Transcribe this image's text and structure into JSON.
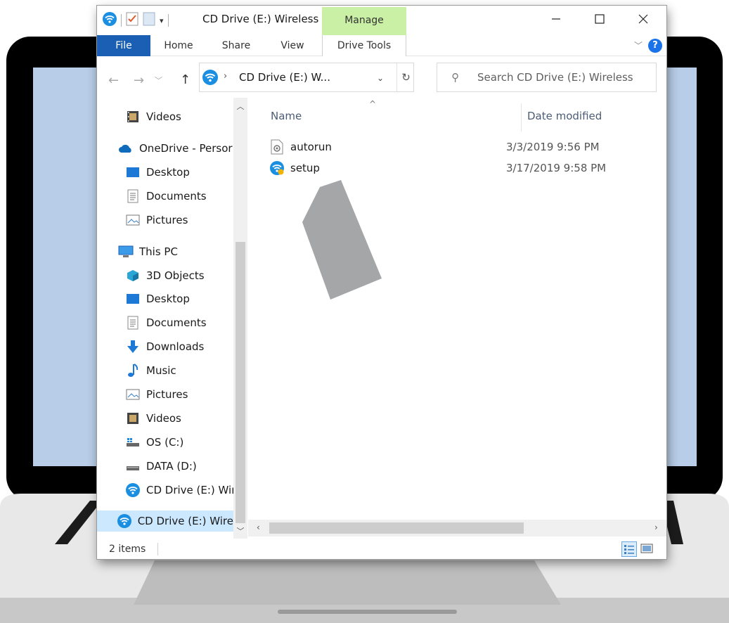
{
  "window": {
    "title": "CD Drive (E:) Wireless",
    "contextual_tab": "Manage",
    "contextual_tab_color": "#c9f0a5"
  },
  "ribbon": {
    "tabs": [
      "File",
      "Home",
      "Share",
      "View",
      "Drive Tools"
    ],
    "file_tab_color": "#1a5fb4"
  },
  "address_bar": {
    "path": "CD Drive (E:) W..."
  },
  "search": {
    "placeholder": "Search CD Drive (E:) Wireless"
  },
  "nav_pane": {
    "items": [
      {
        "label": "Videos",
        "icon": "videos-icon"
      },
      {
        "label": "OneDrive - Persor",
        "icon": "onedrive-icon"
      },
      {
        "label": "Desktop",
        "icon": "desktop-icon"
      },
      {
        "label": "Documents",
        "icon": "documents-icon"
      },
      {
        "label": "Pictures",
        "icon": "pictures-icon"
      },
      {
        "label": "This PC",
        "icon": "this-pc-icon"
      },
      {
        "label": "3D Objects",
        "icon": "3d-objects-icon"
      },
      {
        "label": "Desktop",
        "icon": "desktop-icon"
      },
      {
        "label": "Documents",
        "icon": "documents-icon"
      },
      {
        "label": "Downloads",
        "icon": "downloads-icon"
      },
      {
        "label": "Music",
        "icon": "music-icon"
      },
      {
        "label": "Pictures",
        "icon": "pictures-icon"
      },
      {
        "label": "Videos",
        "icon": "videos-icon"
      },
      {
        "label": "OS (C:)",
        "icon": "os-drive-icon"
      },
      {
        "label": "DATA (D:)",
        "icon": "data-drive-icon"
      },
      {
        "label": "CD Drive (E:) Wir",
        "icon": "wireless-cd-icon"
      },
      {
        "label": "CD Drive (E:) Wire",
        "icon": "wireless-cd-icon",
        "selected": true
      }
    ]
  },
  "content": {
    "columns": [
      "Name",
      "Date modified"
    ],
    "files": [
      {
        "name": "autorun",
        "date_modified": "3/3/2019 9:56 PM",
        "icon": "autorun-file-icon"
      },
      {
        "name": "setup",
        "date_modified": "3/17/2019 9:58 PM",
        "icon": "setup-wireless-icon"
      }
    ]
  },
  "status_bar": {
    "item_count": "2 items"
  },
  "colors": {
    "screen": "#b8cde8",
    "wireless_blue": "#1a8ee0",
    "selected_row": "#cce8ff"
  }
}
